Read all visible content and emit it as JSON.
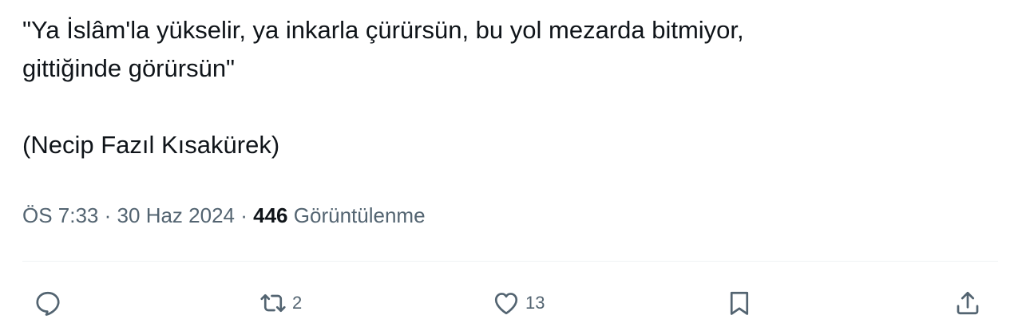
{
  "tweet": {
    "text_lines": [
      "\"Ya İslâm'la yükselir, ya inkarla çürürsün, bu yol mezarda bitmiyor,",
      "gittiğinde görürsün\"",
      "(Necip Fazıl Kısakürek)"
    ]
  },
  "meta": {
    "time": "ÖS 7:33",
    "separator": "·",
    "date": "30 Haz 2024",
    "views_count": "446",
    "views_label": "Görüntülenme"
  },
  "actions": {
    "reply": {
      "icon": "reply-icon",
      "count": ""
    },
    "retweet": {
      "icon": "retweet-icon",
      "count": "2"
    },
    "like": {
      "icon": "heart-icon",
      "count": "13"
    },
    "bookmark": {
      "icon": "bookmark-icon",
      "count": ""
    },
    "share": {
      "icon": "share-icon",
      "count": ""
    }
  },
  "colors": {
    "text": "#0f1419",
    "secondary": "#536471",
    "divider": "#eff3f4"
  }
}
